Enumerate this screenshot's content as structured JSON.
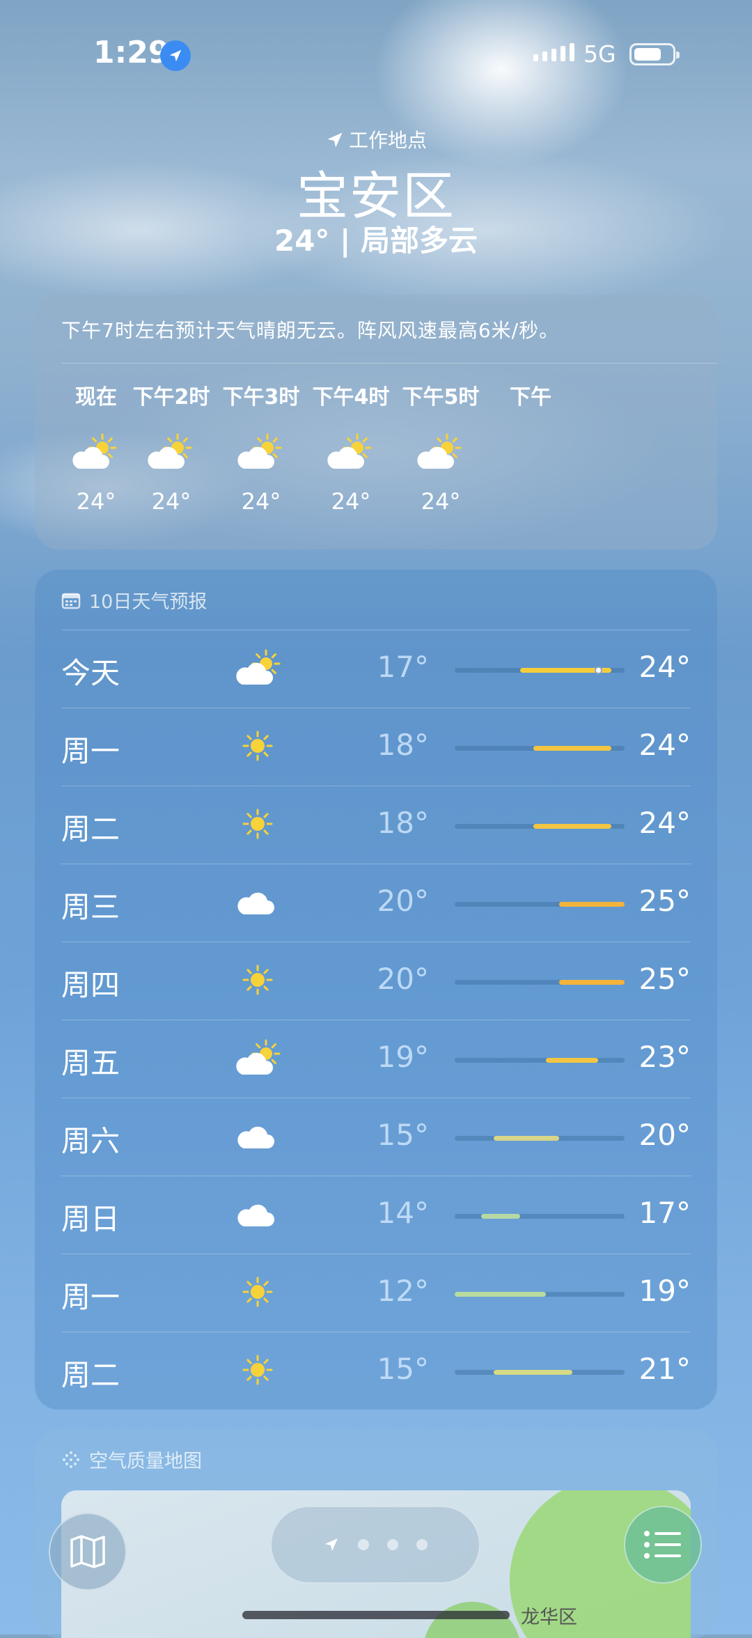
{
  "status": {
    "time": "1:29",
    "network": "5G"
  },
  "header": {
    "location_label": "工作地点",
    "city": "宝安区",
    "condition": "24° | 局部多云"
  },
  "hourly": {
    "summary": "下午7时左右预计天气晴朗无云。阵风风速最高6米/秒。",
    "items": [
      {
        "label": "现在",
        "icon": "partly-sunny-icon",
        "temp": "24°"
      },
      {
        "label": "下午2时",
        "icon": "partly-sunny-icon",
        "temp": "24°"
      },
      {
        "label": "下午3时",
        "icon": "partly-sunny-icon",
        "temp": "24°"
      },
      {
        "label": "下午4时",
        "icon": "partly-sunny-icon",
        "temp": "24°"
      },
      {
        "label": "下午5时",
        "icon": "partly-sunny-icon",
        "temp": "24°"
      },
      {
        "label": "下午",
        "icon": "",
        "temp": ""
      }
    ]
  },
  "daily": {
    "title": "10日天气预报",
    "range_min": 12,
    "range_max": 25,
    "rows": [
      {
        "day": "今天",
        "icon": "partly-sunny-icon",
        "low": "17°",
        "high": "24°",
        "lo": 17,
        "hi": 24,
        "color": "#f4cc3c",
        "current": 23
      },
      {
        "day": "周一",
        "icon": "sun-icon",
        "low": "18°",
        "high": "24°",
        "lo": 18,
        "hi": 24,
        "color": "#f4c542"
      },
      {
        "day": "周二",
        "icon": "sun-icon",
        "low": "18°",
        "high": "24°",
        "lo": 18,
        "hi": 24,
        "color": "#f4c542"
      },
      {
        "day": "周三",
        "icon": "cloud-icon",
        "low": "20°",
        "high": "25°",
        "lo": 20,
        "hi": 25,
        "color": "#f2b43c"
      },
      {
        "day": "周四",
        "icon": "sun-icon",
        "low": "20°",
        "high": "25°",
        "lo": 20,
        "hi": 25,
        "color": "#f2b43c"
      },
      {
        "day": "周五",
        "icon": "partly-sunny-icon",
        "low": "19°",
        "high": "23°",
        "lo": 19,
        "hi": 23,
        "color": "#f4c542"
      },
      {
        "day": "周六",
        "icon": "cloud-icon",
        "low": "15°",
        "high": "20°",
        "lo": 15,
        "hi": 20,
        "color": "#d8d58a"
      },
      {
        "day": "周日",
        "icon": "cloud-icon",
        "low": "14°",
        "high": "17°",
        "lo": 14,
        "hi": 17,
        "color": "#b6d8a4"
      },
      {
        "day": "周一",
        "icon": "sun-icon",
        "low": "12°",
        "high": "19°",
        "lo": 12,
        "hi": 19,
        "color": "#b8dca0"
      },
      {
        "day": "周二",
        "icon": "sun-icon",
        "low": "15°",
        "high": "21°",
        "lo": 15,
        "hi": 21,
        "color": "#d6da84"
      }
    ]
  },
  "air_quality": {
    "title": "空气质量地图",
    "district": "龙华区"
  },
  "colors": {
    "sun": "#f7d23a",
    "cloud": "#ffffff",
    "accent_list": "#6ebe96"
  }
}
